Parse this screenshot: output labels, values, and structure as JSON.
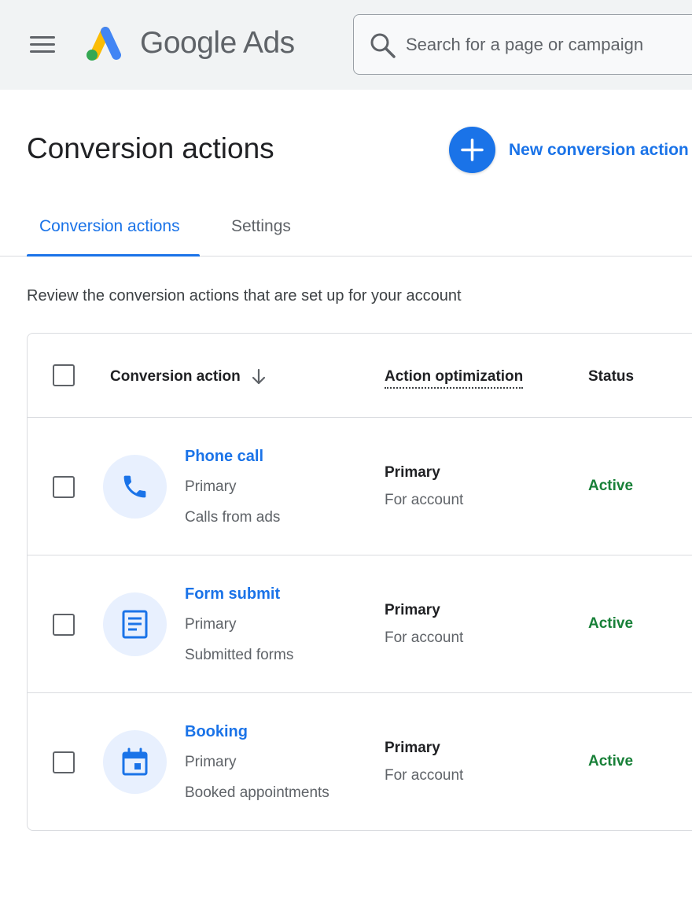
{
  "app": {
    "brand": "Google Ads"
  },
  "search": {
    "placeholder": "Search for a page or campaign"
  },
  "page": {
    "title": "Conversion actions",
    "new_button_label": "New conversion action",
    "description": "Review the conversion actions that are set up for your account"
  },
  "tabs": [
    {
      "label": "Conversion actions",
      "selected": true
    },
    {
      "label": "Settings",
      "selected": false
    }
  ],
  "table": {
    "headers": {
      "conversion_action": "Conversion action",
      "action_optimization": "Action optimization",
      "status": "Status"
    },
    "rows": [
      {
        "icon": "phone-icon",
        "name": "Phone call",
        "category": "Primary",
        "detail": "Calls from ads",
        "optimization": "Primary",
        "optimization_scope": "For account",
        "status": "Active"
      },
      {
        "icon": "form-icon",
        "name": "Form submit",
        "category": "Primary",
        "detail": "Submitted forms",
        "optimization": "Primary",
        "optimization_scope": "For account",
        "status": "Active"
      },
      {
        "icon": "calendar-icon",
        "name": "Booking",
        "category": "Primary",
        "detail": "Booked appointments",
        "optimization": "Primary",
        "optimization_scope": "For account",
        "status": "Active"
      }
    ]
  },
  "colors": {
    "accent": "#1a73e8",
    "status_active": "#188038",
    "topbar_bg": "#f1f3f4",
    "icon_circle_bg": "#e8f0fe"
  }
}
